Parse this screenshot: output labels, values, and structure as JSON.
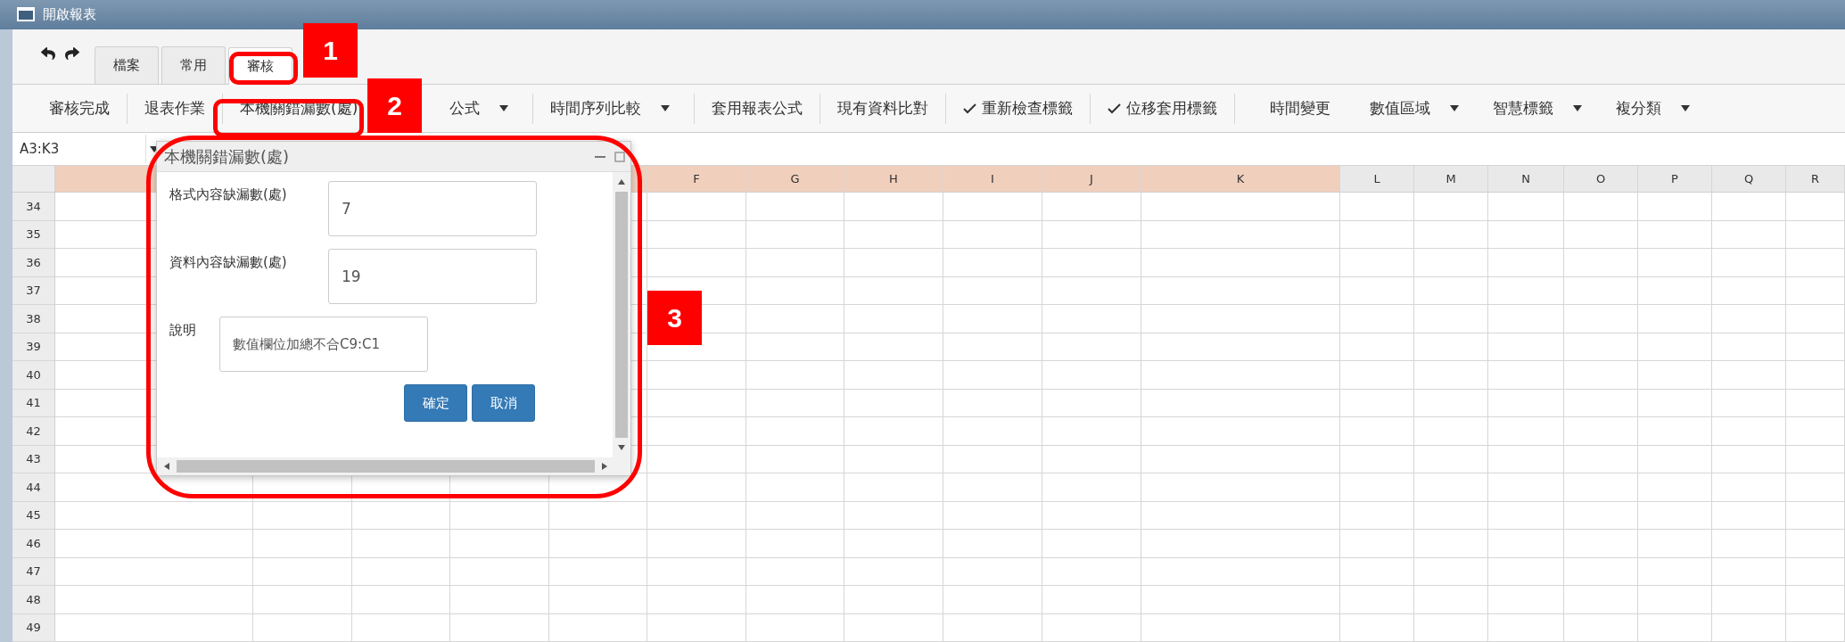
{
  "window": {
    "title": "開啟報表"
  },
  "tabs": [
    {
      "label": "檔案",
      "selected": false
    },
    {
      "label": "常用",
      "selected": false
    },
    {
      "label": "審核",
      "selected": true
    }
  ],
  "toolbar": {
    "groups": [
      [
        {
          "label": "審核完成",
          "kind": "plain"
        }
      ],
      [
        {
          "label": "退表作業",
          "kind": "plain"
        }
      ],
      [
        {
          "label": "本機關錯漏數(處)",
          "kind": "plain"
        }
      ],
      [
        {
          "label": "公式",
          "kind": "dropdown"
        }
      ],
      [
        {
          "label": "時間序列比較",
          "kind": "dropdown"
        }
      ],
      [
        {
          "label": "套用報表公式",
          "kind": "plain"
        }
      ],
      [
        {
          "label": "現有資料比對",
          "kind": "plain"
        }
      ],
      [
        {
          "label": "重新檢查標籤",
          "kind": "check"
        }
      ],
      [
        {
          "label": "位移套用標籤",
          "kind": "check"
        }
      ],
      [
        {
          "label": "時間變更",
          "kind": "plain"
        },
        {
          "label": "數值區域",
          "kind": "dropdown"
        },
        {
          "label": "智慧標籤",
          "kind": "dropdown"
        },
        {
          "label": "複分類",
          "kind": "dropdown"
        }
      ]
    ]
  },
  "name_box": {
    "value": "A3:K3"
  },
  "sheet": {
    "columns": [
      {
        "selected": true
      },
      {},
      {},
      {},
      {
        "selected": true
      },
      {
        "label": "F",
        "selected": true
      },
      {
        "label": "G",
        "selected": true
      },
      {
        "label": "H",
        "selected": true
      },
      {
        "label": "I",
        "selected": true
      },
      {
        "label": "J",
        "selected": true
      },
      {
        "label": "K",
        "selected": true
      },
      {
        "label": "L",
        "selected": false
      },
      {
        "label": "M",
        "selected": false
      },
      {
        "label": "N",
        "selected": false
      },
      {
        "label": "O",
        "selected": false
      },
      {
        "label": "P",
        "selected": false
      },
      {
        "label": "Q",
        "selected": false
      },
      {
        "label": "R",
        "selected": false
      }
    ],
    "rows": [
      "34",
      "35",
      "36",
      "37",
      "38",
      "39",
      "40",
      "41",
      "42",
      "43",
      "44",
      "45",
      "46",
      "47",
      "48",
      "49"
    ]
  },
  "dialog": {
    "title": "本機關錯漏數(處)",
    "fields": [
      {
        "label": "格式內容缺漏數(處)",
        "value": "7",
        "kind": "number"
      },
      {
        "label": "資料內容缺漏數(處)",
        "value": "19",
        "kind": "number"
      },
      {
        "label": "說明",
        "value": "數值欄位加總不合C9:C1",
        "kind": "text"
      }
    ],
    "buttons": [
      {
        "label": "確定"
      },
      {
        "label": "取消"
      }
    ]
  },
  "annotations": [
    {
      "label": "1"
    },
    {
      "label": "2"
    },
    {
      "label": "3"
    }
  ]
}
